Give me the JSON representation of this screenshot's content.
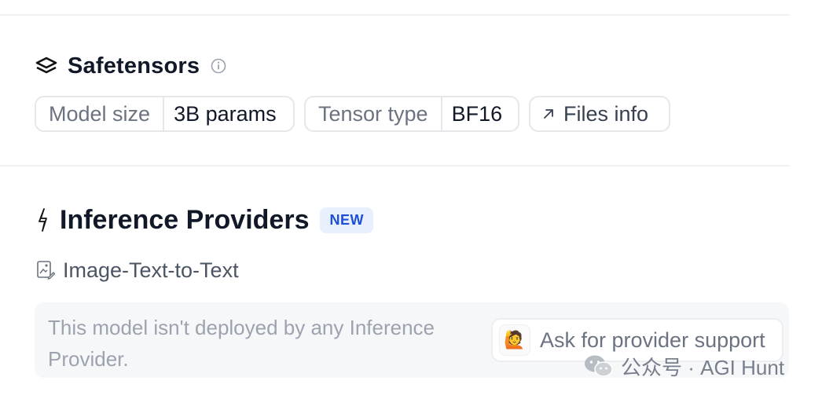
{
  "safetensors": {
    "title": "Safetensors",
    "chips": {
      "model_size_label": "Model size",
      "model_size_value": "3B params",
      "tensor_type_label": "Tensor type",
      "tensor_type_value": "BF16",
      "files_info_label": "Files info"
    }
  },
  "inference": {
    "title": "Inference Providers",
    "badge": "NEW",
    "task": "Image-Text-to-Text",
    "message": "This model isn't deployed by any Inference Provider.",
    "ask_button": "Ask for provider support",
    "ask_emoji": "🙋"
  },
  "watermark": "公众号 · AGI Hunt",
  "colors": {
    "badge_bg": "#e8f0fe",
    "badge_text": "#1d4ed8",
    "muted": "#9ca3af"
  },
  "icons": [
    "layers-icon",
    "info-icon",
    "arrow-up-right-icon",
    "spark-icon",
    "image-edit-icon",
    "raising-hand-emoji",
    "wechat-icon"
  ]
}
